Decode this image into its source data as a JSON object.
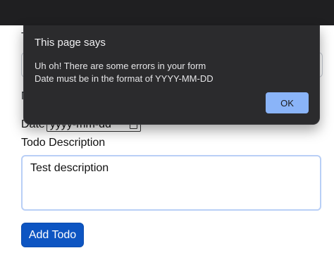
{
  "page": {
    "title_fragment": "T",
    "field_label_fragment": "N",
    "date_label": "Date",
    "date_placeholder": "yyyy-mm-dd",
    "description_label": "Todo Description",
    "description_value": "Test description",
    "submit_label": "Add Todo"
  },
  "dialog": {
    "title": "This page says",
    "message": "Uh oh! There are some errors in your form\nDate must be in the format of YYYY-MM-DD",
    "ok_label": "OK"
  },
  "icons": {
    "calendar": "calendar-icon"
  },
  "colors": {
    "topbar": "#1f1f21",
    "dialog_bg": "#2b2b2d",
    "ok_button": "#8ab4f8",
    "primary_button": "#0d55c2"
  }
}
